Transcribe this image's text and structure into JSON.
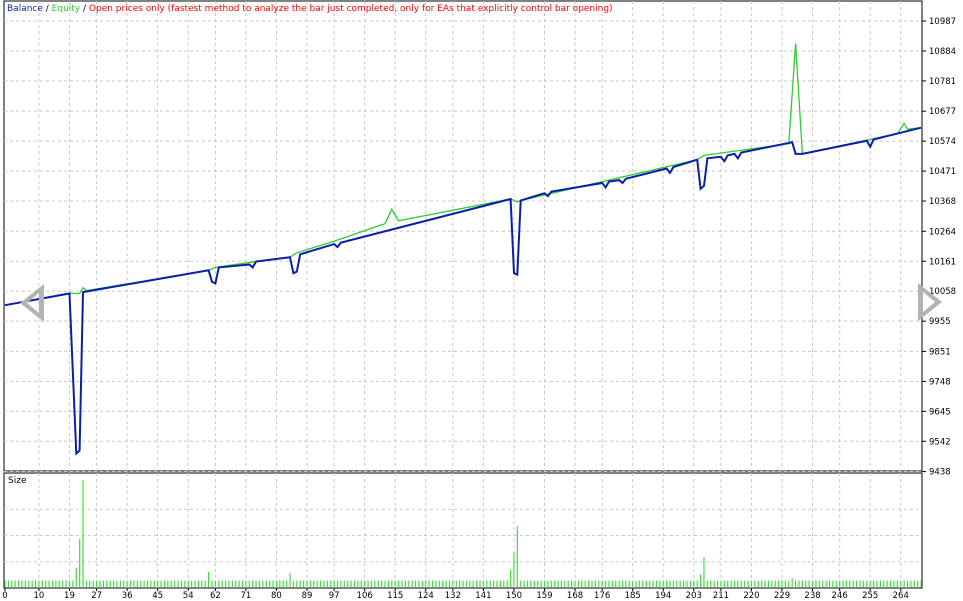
{
  "legend": {
    "balance": "Balance",
    "sep1": " / ",
    "equity": "Equity",
    "sep2": " / ",
    "mode": "Open prices only (fastest method to analyze the bar just completed, only for EAs that explicitly control bar opening)"
  },
  "colors": {
    "balance": "#0b1ea8",
    "equity": "#2ecc2e",
    "mode_text": "#ff0000",
    "size_bars": "#3ee03e",
    "grid": "#c8c8c8",
    "arrows": "#b3b3b3"
  },
  "icons": {
    "left": "left-triangle-arrow-icon",
    "right": "right-triangle-arrow-icon"
  },
  "chart_data": [
    {
      "type": "line",
      "title": "",
      "legend_position": "top-left",
      "grid": true,
      "xlim": [
        0,
        270
      ],
      "ylim": [
        9438,
        11050
      ],
      "yticks": [
        10987,
        10884,
        10781,
        10677,
        10574,
        10471,
        10368,
        10264,
        10161,
        10058,
        9955,
        9851,
        9748,
        9645,
        9542,
        9438
      ],
      "series": [
        {
          "name": "Balance",
          "points": [
            [
              0,
              10010
            ],
            [
              19,
              10050
            ],
            [
              21,
              9500
            ],
            [
              22,
              9510
            ],
            [
              23,
              10055
            ],
            [
              60,
              10130
            ],
            [
              61,
              10090
            ],
            [
              62,
              10085
            ],
            [
              63,
              10140
            ],
            [
              72,
              10150
            ],
            [
              73,
              10140
            ],
            [
              74,
              10160
            ],
            [
              84,
              10175
            ],
            [
              85,
              10120
            ],
            [
              86,
              10125
            ],
            [
              87,
              10185
            ],
            [
              97,
              10220
            ],
            [
              98,
              10210
            ],
            [
              99,
              10225
            ],
            [
              149,
              10375
            ],
            [
              150,
              10120
            ],
            [
              151,
              10115
            ],
            [
              152,
              10370
            ],
            [
              159,
              10395
            ],
            [
              160,
              10385
            ],
            [
              161,
              10400
            ],
            [
              176,
              10430
            ],
            [
              177,
              10415
            ],
            [
              178,
              10435
            ],
            [
              181,
              10440
            ],
            [
              182,
              10430
            ],
            [
              183,
              10445
            ],
            [
              195,
              10480
            ],
            [
              196,
              10465
            ],
            [
              197,
              10485
            ],
            [
              204,
              10510
            ],
            [
              205,
              10410
            ],
            [
              206,
              10420
            ],
            [
              207,
              10515
            ],
            [
              211,
              10520
            ],
            [
              212,
              10505
            ],
            [
              213,
              10525
            ],
            [
              215,
              10530
            ],
            [
              216,
              10515
            ],
            [
              217,
              10535
            ],
            [
              232,
              10570
            ],
            [
              233,
              10530
            ],
            [
              235,
              10530
            ],
            [
              254,
              10575
            ],
            [
              255,
              10555
            ],
            [
              256,
              10580
            ],
            [
              270,
              10620
            ]
          ]
        },
        {
          "name": "Equity",
          "points": [
            [
              0,
              10010
            ],
            [
              19,
              10050
            ],
            [
              22,
              10050
            ],
            [
              23,
              10070
            ],
            [
              24,
              10060
            ],
            [
              60,
              10130
            ],
            [
              62,
              10140
            ],
            [
              74,
              10160
            ],
            [
              84,
              10175
            ],
            [
              86,
              10190
            ],
            [
              97,
              10230
            ],
            [
              112,
              10290
            ],
            [
              114,
              10340
            ],
            [
              116,
              10300
            ],
            [
              149,
              10375
            ],
            [
              151,
              10365
            ],
            [
              152,
              10370
            ],
            [
              204,
              10510
            ],
            [
              206,
              10525
            ],
            [
              231,
              10565
            ],
            [
              233,
              10910
            ],
            [
              235,
              10530
            ],
            [
              263,
              10600
            ],
            [
              265,
              10635
            ],
            [
              266,
              10615
            ],
            [
              270,
              10620
            ]
          ]
        }
      ]
    },
    {
      "type": "bar",
      "title": "Size",
      "grid": true,
      "xlim": [
        0,
        270
      ],
      "xticks": [
        0,
        10,
        19,
        27,
        36,
        45,
        54,
        62,
        71,
        80,
        89,
        97,
        106,
        115,
        124,
        132,
        141,
        150,
        159,
        168,
        176,
        185,
        194,
        203,
        211,
        220,
        229,
        238,
        246,
        255,
        264
      ],
      "ylim": [
        0,
        1
      ],
      "base_value": 0.06,
      "special": [
        {
          "x": 21,
          "value": 0.18
        },
        {
          "x": 22,
          "value": 0.45
        },
        {
          "x": 23,
          "value": 1.0
        },
        {
          "x": 60,
          "value": 0.14
        },
        {
          "x": 84,
          "value": 0.13
        },
        {
          "x": 149,
          "value": 0.16
        },
        {
          "x": 150,
          "value": 0.32
        },
        {
          "x": 151,
          "value": 0.57
        },
        {
          "x": 205,
          "value": 0.12
        },
        {
          "x": 206,
          "value": 0.28
        },
        {
          "x": 232,
          "value": 0.08
        }
      ]
    }
  ]
}
